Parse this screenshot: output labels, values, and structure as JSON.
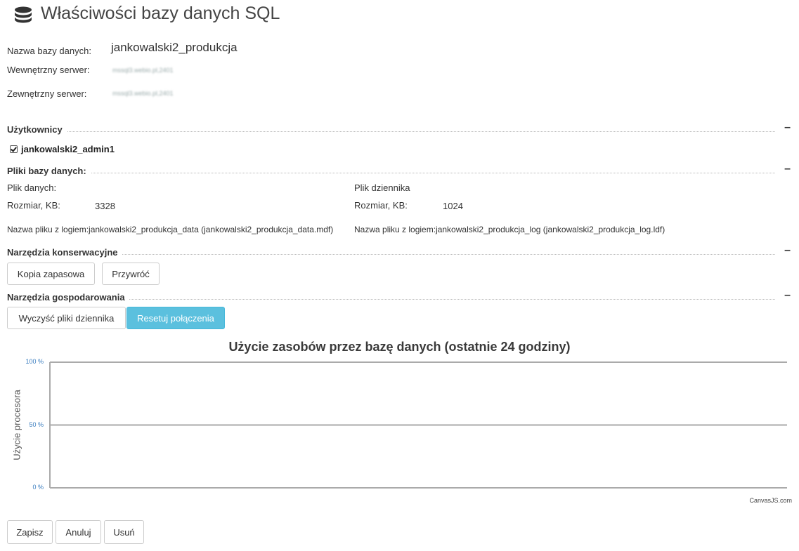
{
  "page": {
    "title": "Właściwości bazy danych SQL",
    "icon": "database-icon"
  },
  "db_info": {
    "name_label": "Nazwa bazy danych:",
    "name_value": "jankowalski2_produkcja",
    "internal_label": "Wewnętrzny serwer:",
    "internal_value": "mssql3.webio.pl,2401",
    "external_label": "Zewnętrzny serwer:",
    "external_value": "mssql3.webio.pl,2401"
  },
  "users": {
    "title": "Użytkownicy",
    "toggle": "–",
    "items": [
      {
        "name": "jankowalski2_admin1",
        "checked": true
      }
    ]
  },
  "files": {
    "title": "Pliki bazy danych:",
    "toggle": "–",
    "data": {
      "heading": "Plik danych:",
      "size_label": "Rozmiar, KB:",
      "size_value": "3328",
      "logical_label": "Nazwa pliku z logiem:",
      "logical_value": "jankowalski2_produkcja_data (jankowalski2_produkcja_data.mdf)"
    },
    "log": {
      "heading": "Plik dziennika",
      "size_label": "Rozmiar, KB:",
      "size_value": "1024",
      "logical_label": "Nazwa pliku z logiem:",
      "logical_value": "jankowalski2_produkcja_log (jankowalski2_produkcja_log.ldf)"
    }
  },
  "maintenance": {
    "title": "Narzędzia konserwacyjne",
    "toggle": "–",
    "backup_label": "Kopia zapasowa",
    "restore_label": "Przywróć"
  },
  "management": {
    "title": "Narzędzia gospodarowania",
    "toggle": "–",
    "clear_logs_label": "Wyczyść pliki dziennika",
    "reset_connections_label": "Resetuj połączenia",
    "accent": "#5bc0de"
  },
  "chart_data": {
    "type": "line",
    "title": "Użycie zasobów przez bazę danych (ostatnie 24 godziny)",
    "ylabel": "Użycie procesora",
    "xlabel": "",
    "ylim": [
      0,
      100
    ],
    "yticks": [
      "0 %",
      "50 %",
      "100 %"
    ],
    "series": [],
    "grid": true,
    "credit": "CanvasJS.com"
  },
  "footer": {
    "save_label": "Zapisz",
    "cancel_label": "Anuluj",
    "delete_label": "Usuń"
  }
}
